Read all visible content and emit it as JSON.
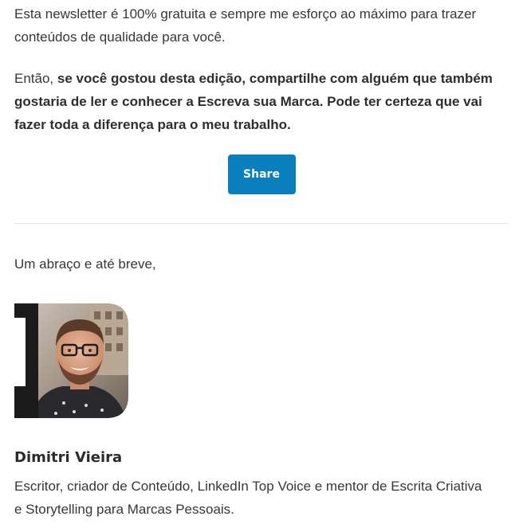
{
  "intro": {
    "paragraph": "Esta newsletter é 100% gratuita e sempre me esforço ao máximo para trazer conteúdos de qualidade para você."
  },
  "cta": {
    "prefix": "Então, ",
    "bold_text": "se você gostou desta edição, compartilhe com alguém que também gostaria de ler e conhecer a Escreva sua Marca. Pode ter certeza que vai fazer toda a diferença para o meu trabalho.",
    "share_label": "Share"
  },
  "signature": {
    "closing": "Um abraço e até breve,",
    "author_name": "Dimitri Vieira",
    "author_bio": "Escritor, criador de Conteúdo, LinkedIn Top Voice e mentor de Escrita Criativa e Storytelling para Marcas Pessoais."
  },
  "colors": {
    "share_button": "#0a7fbc",
    "text": "#363737",
    "divider": "#e3e3e3"
  }
}
